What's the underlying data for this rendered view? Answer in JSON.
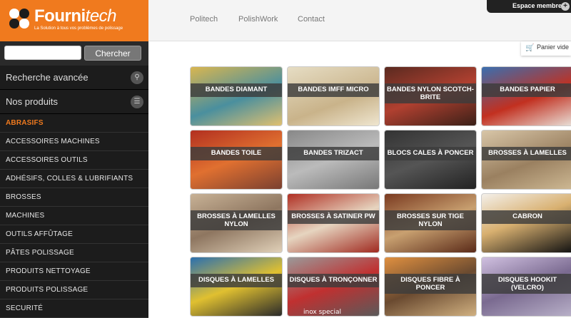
{
  "logo": {
    "name_part1": "Fourni",
    "name_part2": "tech",
    "tagline": "La Solution à tous vos problèmes de polissage"
  },
  "search": {
    "placeholder": "",
    "button_label": "Chercher"
  },
  "sidebar": {
    "advanced_search": "Recherche avancée",
    "products_heading": "Nos produits",
    "items": [
      {
        "label": "ABRASIFS",
        "active": true
      },
      {
        "label": "ACCESSOIRES MACHINES"
      },
      {
        "label": "ACCESSOIRES OUTILS"
      },
      {
        "label": "ADHÉSIFS, COLLES & LUBRIFIANTS"
      },
      {
        "label": "BROSSES"
      },
      {
        "label": "MACHINES"
      },
      {
        "label": "OUTILS AFFÛTAGE"
      },
      {
        "label": "PÂTES POLISSAGE"
      },
      {
        "label": "PRODUITS NETTOYAGE"
      },
      {
        "label": "PRODUITS POLISSAGE"
      },
      {
        "label": "SECURITÉ"
      }
    ]
  },
  "topnav": {
    "links": [
      "Politech",
      "PolishWork",
      "Contact"
    ],
    "espace": "Espace membres",
    "panier": "Panier vide"
  },
  "products": [
    "BANDES DIAMANT",
    "BANDES IMFF MICRO",
    "BANDES NYLON SCOTCH-BRITE",
    "BANDES PAPIER",
    "BANDES TOILE",
    "BANDES TRIZACT",
    "BLOCS CALES À PONCER",
    "BROSSES À LAMELLES",
    "BROSSES À LAMELLES NYLON",
    "BROSSES À SATINER PW",
    "BROSSES SUR TIGE NYLON",
    "CABRON",
    "DISQUES À LAMELLES",
    "DISQUES À TRONÇONNER",
    "DISQUES FIBRE À PONCER",
    "DISQUES HOOKIT (VELCRO)"
  ],
  "image_text": {
    "inox": "inox special"
  },
  "colors": {
    "brand_orange": "#f07a1e",
    "sidebar_bg": "#1c1c1c"
  }
}
